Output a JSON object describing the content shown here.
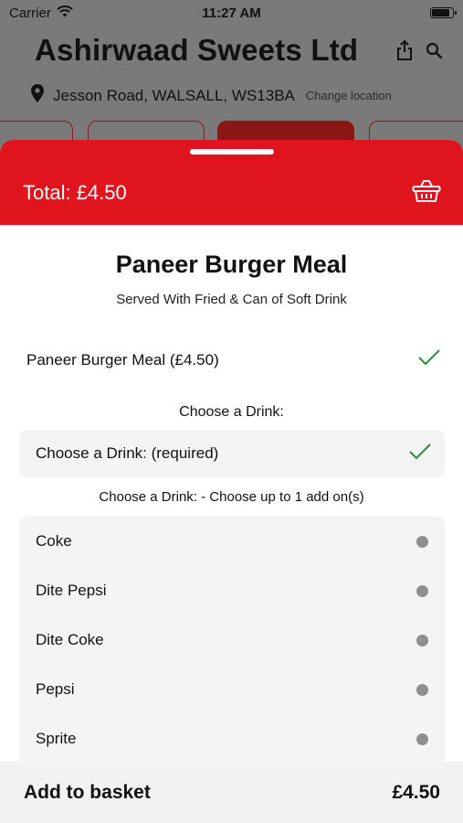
{
  "status": {
    "carrier": "Carrier",
    "time": "11:27 AM",
    "battery_level": 0.92
  },
  "header": {
    "store_name": "Ashirwaad Sweets Ltd",
    "address": "Jesson Road, WALSALL, WS13BA",
    "change_location": "Change location"
  },
  "sheet": {
    "total": "Total: £4.50",
    "item": {
      "title": "Paneer Burger Meal",
      "subtitle": "Served With Fried & Can of Soft Drink",
      "base_option": "Paneer Burger Meal (£4.50)"
    },
    "section_label": "Choose a Drink:",
    "required_label": "Choose a Drink: (required)",
    "addon_label": "Choose a Drink: - Choose up to 1 add on(s)",
    "drinks": [
      {
        "name": "Coke"
      },
      {
        "name": "Dite Pepsi"
      },
      {
        "name": "Dite Coke"
      },
      {
        "name": "Pepsi"
      },
      {
        "name": "Sprite"
      }
    ],
    "add_to_basket": "Add to basket",
    "price": "£4.50"
  },
  "colors": {
    "brand_red": "#e0141c",
    "check_green": "#2e8b3a"
  }
}
